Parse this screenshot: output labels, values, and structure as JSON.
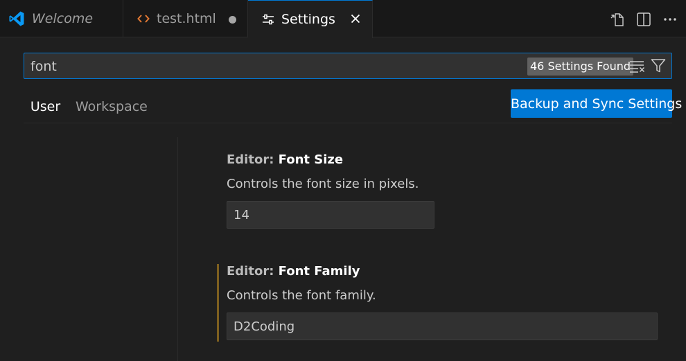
{
  "tabs": [
    {
      "label": "Welcome",
      "icon": "vscode-logo-icon",
      "italic": true
    },
    {
      "label": "test.html",
      "icon": "html-code-icon",
      "dirty": true
    },
    {
      "label": "Settings",
      "icon": "settings-sliders-icon",
      "active": true
    }
  ],
  "editor_actions": [
    "open-settings-json-icon",
    "split-editor-icon",
    "more-actions-icon"
  ],
  "search": {
    "value": "font",
    "result_count": "46 Settings Found",
    "clear_icon": "clear-filter-icon",
    "filter_icon": "filter-icon"
  },
  "scope_tabs": {
    "user": "User",
    "workspace": "Workspace",
    "active": "User"
  },
  "sync_button": "Backup and Sync Settings",
  "settings": [
    {
      "category": "Editor: ",
      "name": "Font Size",
      "description": "Controls the font size in pixels.",
      "value": "14"
    },
    {
      "category": "Editor: ",
      "name": "Font Family",
      "description": "Controls the font family.",
      "value": "D2Coding",
      "modified": true
    }
  ],
  "colors": {
    "accent": "#0078d4",
    "modified_indicator": "#7d5f1f",
    "html_icon": "#e37933",
    "logo": "#0a99f4"
  }
}
